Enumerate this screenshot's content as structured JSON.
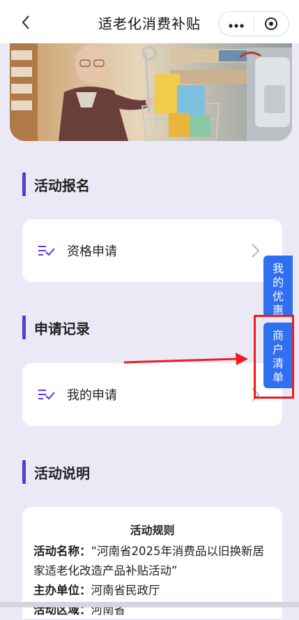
{
  "header": {
    "title": "适老化消费补贴",
    "more_icon": "more-icon",
    "close_icon": "target-close-icon"
  },
  "sections": {
    "registration_title": "活动报名",
    "records_title": "申请记录",
    "description_title": "活动说明"
  },
  "cards": {
    "eligibility_label": "资格申请",
    "my_application_label": "我的申请"
  },
  "side_tabs": {
    "coupons": [
      "我",
      "的",
      "优",
      "惠"
    ],
    "merchants": [
      "商",
      "户",
      "清",
      "单"
    ]
  },
  "rules": {
    "title": "活动规则",
    "name_label": "活动名称：",
    "name_value": "“河南省2025年消费品以旧换新居家适老化改造产品补贴活动”",
    "organizer_label": "主办单位：",
    "organizer_value": "河南省民政厅",
    "area_label": "活动区域：",
    "area_value": "河南省"
  },
  "colors": {
    "accent": "#5b3ad6",
    "side_tab": "#2f6ff0",
    "highlight": "#ef1c1c",
    "background": "#ece9f7"
  }
}
